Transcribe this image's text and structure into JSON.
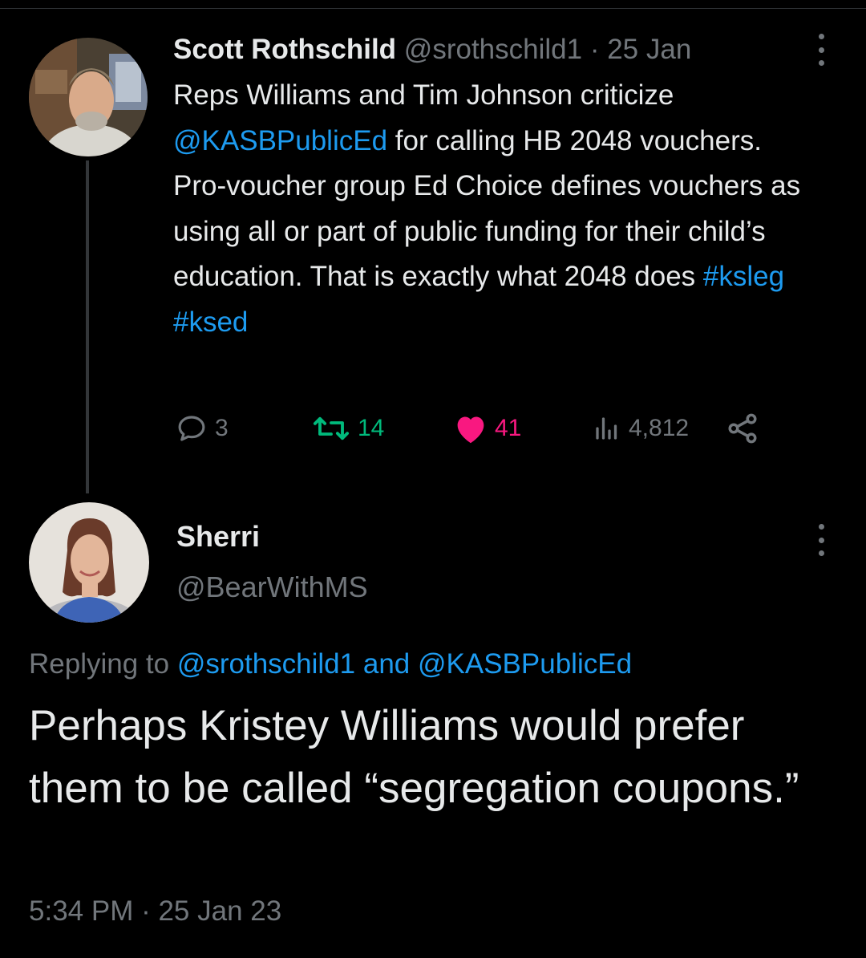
{
  "tweet": {
    "author_name": "Scott Rothschild",
    "author_handle": "@srothschild1",
    "separator": " · ",
    "date": "25 Jan",
    "text_1": "Reps Williams and Tim Johnson criticize ",
    "mention": "@KASBPublicEd",
    "text_2": " for calling HB 2048 vouchers. Pro-voucher group Ed Choice defines vouchers as using all or part of public funding for their child’s education. That is exactly what 2048 does ",
    "hashtag_1": "#ksleg",
    "hashtag_2": "#ksed",
    "stats": {
      "replies": "3",
      "retweets": "14",
      "likes": "41",
      "views": "4,812"
    }
  },
  "reply": {
    "author_name": "Sherri",
    "author_handle": "@BearWithMS",
    "replying_prefix": "Replying to ",
    "replying_mention_1": "@srothschild1",
    "replying_and": " and ",
    "replying_mention_2": "@KASBPublicEd",
    "text": "Perhaps Kristey Williams would prefer them to be called “segregation coupons.”",
    "time": "5:34 PM",
    "separator": " · ",
    "date": "25 Jan 23"
  },
  "colors": {
    "background": "#000000",
    "text": "#e7e9ea",
    "muted": "#71767b",
    "link": "#1d9bf0",
    "retweet": "#00ba7c",
    "like": "#f91880"
  },
  "icons": [
    "more-icon",
    "reply-icon",
    "retweet-icon",
    "like-icon",
    "views-icon",
    "share-icon"
  ]
}
